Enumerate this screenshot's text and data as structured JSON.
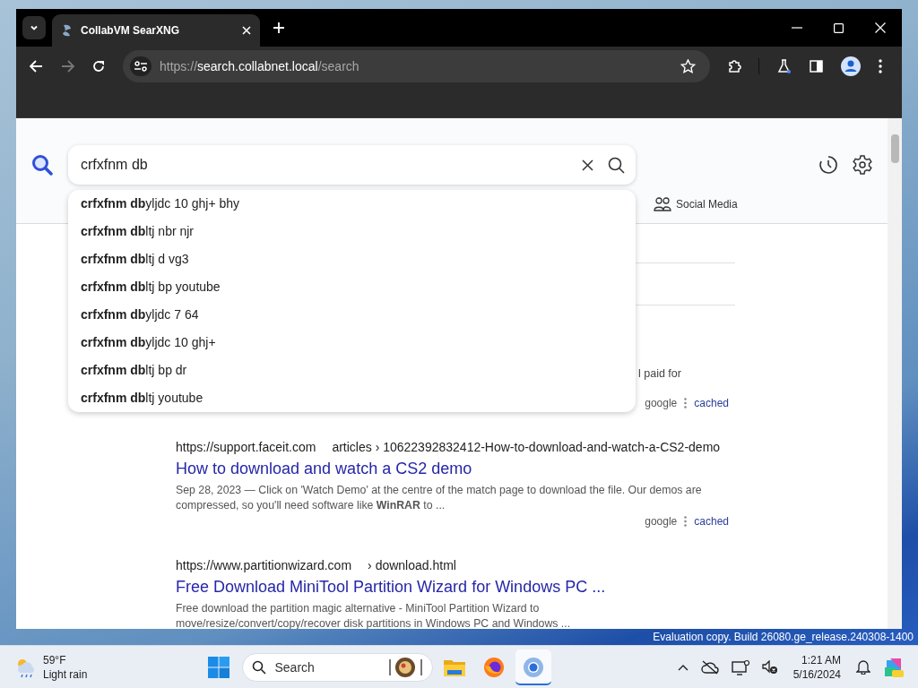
{
  "browser": {
    "tab_title": "CollabVM SearXNG",
    "url": {
      "scheme": "https://",
      "host": "search.collabnet.local",
      "path": "/search"
    }
  },
  "search": {
    "query": "crfxfnm db",
    "suggestions": [
      "**crfxfnm db**yljdc 10 ghj+ bhy",
      "**crfxfnm db**ltj nbr njr",
      "**crfxfnm db**ltj d vg3",
      "**crfxfnm db**ltj bp youtube",
      "**crfxfnm db**yljdc 7 64",
      "**crfxfnm db**yljdc 10 ghj+",
      "**crfxfnm db**ltj bp dr",
      "**crfxfnm db**ltj youtube"
    ]
  },
  "categories": [
    {
      "label": "Social Media"
    }
  ],
  "results": [
    {
      "kind": "partial",
      "snippet": "l paid for",
      "engine": "google",
      "cached": "cached"
    },
    {
      "kind": "full",
      "host": "https://support.faceit.com",
      "path": "articles › 10622392832412-How-to-download-and-watch-a-CS2-demo",
      "title": "How to download and watch a CS2 demo",
      "snippet": "Sep 28, 2023 — Click on 'Watch Demo' at the centre of the match page to download the file. Our demos are compressed, so you'll need software like **WinRAR** to ...",
      "engine": "google",
      "cached": "cached"
    },
    {
      "kind": "full",
      "host": "https://www.partitionwizard.com",
      "path": "› download.html",
      "title": "Free Download MiniTool Partition Wizard for Windows PC ...",
      "snippet": "Free download the partition magic alternative - MiniTool Partition Wizard to move/resize/convert/copy/recover disk partitions in Windows PC and Windows ..."
    }
  ],
  "watermark": "Evaluation copy. Build 26080.ge_release.240308-1400",
  "taskbar": {
    "weather": {
      "temperature": "59°F",
      "condition": "Light rain"
    },
    "search_placeholder": "Search",
    "apps": [
      {
        "kind": "explorer",
        "active": false
      },
      {
        "kind": "firefox",
        "active": false
      },
      {
        "kind": "chrome",
        "active": true
      }
    ],
    "time": "1:21 AM",
    "date": "5/16/2024"
  }
}
